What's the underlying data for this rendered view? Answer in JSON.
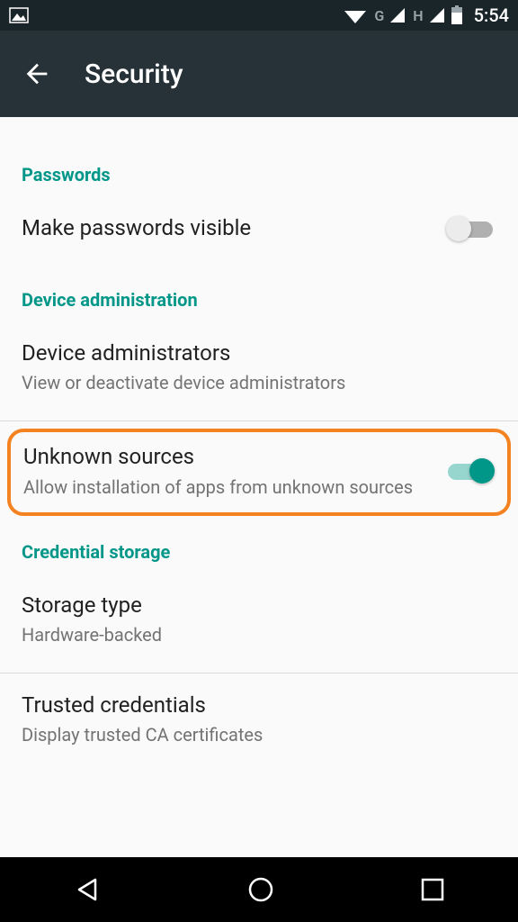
{
  "status": {
    "time": "5:54",
    "net1": "G",
    "net2": "H"
  },
  "header": {
    "title": "Security"
  },
  "sections": {
    "passwords": {
      "header": "Passwords",
      "make_visible": {
        "title": "Make passwords visible"
      }
    },
    "device_admin": {
      "header": "Device administration",
      "admins": {
        "title": "Device administrators",
        "sub": "View or deactivate device administrators"
      },
      "unknown": {
        "title": "Unknown sources",
        "sub": "Allow installation of apps from unknown sources"
      }
    },
    "credential": {
      "header": "Credential storage",
      "storage_type": {
        "title": "Storage type",
        "sub": "Hardware-backed"
      },
      "trusted": {
        "title": "Trusted credentials",
        "sub": "Display trusted CA certificates"
      }
    }
  }
}
